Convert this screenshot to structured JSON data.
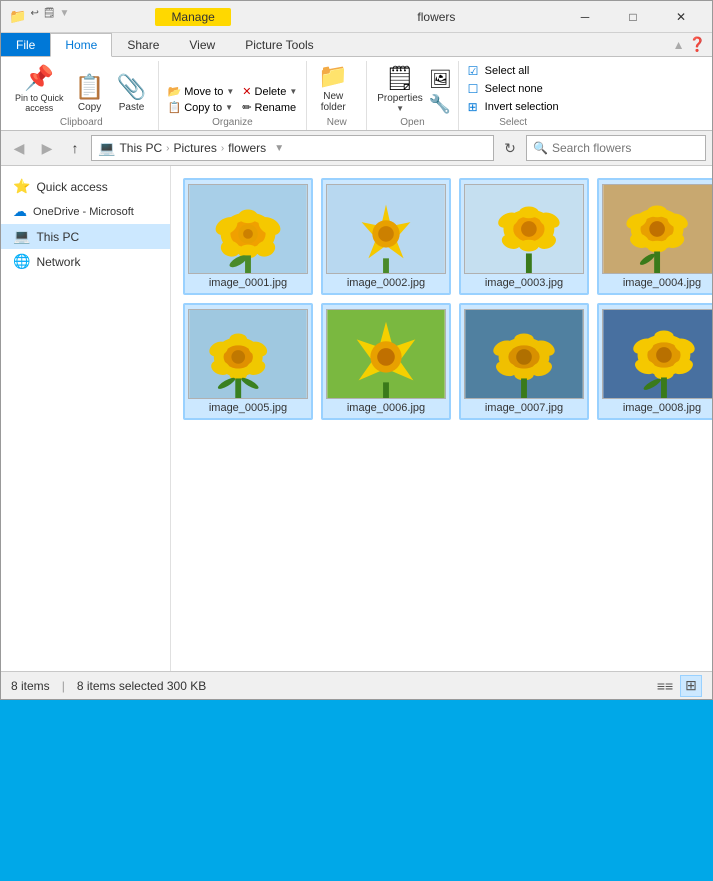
{
  "window": {
    "title": "flowers",
    "manage_tab": "Manage"
  },
  "titlebar": {
    "controls": {
      "minimize": "─",
      "maximize": "□",
      "close": "✕"
    }
  },
  "ribbon": {
    "tabs": [
      "File",
      "Home",
      "Share",
      "View",
      "Picture Tools"
    ],
    "active_tab": "Home",
    "clipboard_group": {
      "label": "Clipboard",
      "pin_label": "Pin to Quick\naccess",
      "copy_label": "Copy",
      "paste_label": "Paste"
    },
    "organize_group": {
      "label": "Organize",
      "move_to_label": "Move to",
      "copy_to_label": "Copy to",
      "delete_label": "Delete",
      "rename_label": "Rename"
    },
    "new_group": {
      "label": "New",
      "new_folder_label": "New\nfolder"
    },
    "open_group": {
      "label": "Open",
      "properties_label": "Properties"
    },
    "select_group": {
      "label": "Select",
      "select_all": "Select all",
      "select_none": "Select none",
      "invert_selection": "Invert selection"
    }
  },
  "addressbar": {
    "back_disabled": true,
    "forward_disabled": true,
    "up_enabled": true,
    "crumbs": [
      "This PC",
      "Pictures",
      "flowers"
    ],
    "search_placeholder": "Search flowers"
  },
  "sidebar": {
    "items": [
      {
        "id": "quick-access",
        "label": "Quick access",
        "icon": "⭐"
      },
      {
        "id": "onedrive",
        "label": "OneDrive - Microsoft",
        "icon": "☁"
      },
      {
        "id": "this-pc",
        "label": "This PC",
        "icon": "💻",
        "active": true
      },
      {
        "id": "network",
        "label": "Network",
        "icon": "🌐"
      }
    ]
  },
  "files": [
    {
      "name": "image_0001.jpg",
      "selected": true
    },
    {
      "name": "image_0002.jpg",
      "selected": true
    },
    {
      "name": "image_0003.jpg",
      "selected": true
    },
    {
      "name": "image_0004.jpg",
      "selected": true
    },
    {
      "name": "image_0005.jpg",
      "selected": true
    },
    {
      "name": "image_0006.jpg",
      "selected": true
    },
    {
      "name": "image_0007.jpg",
      "selected": true
    },
    {
      "name": "image_0008.jpg",
      "selected": true
    }
  ],
  "statusbar": {
    "item_count": "8 items",
    "selected_info": "8 items selected  300 KB"
  }
}
